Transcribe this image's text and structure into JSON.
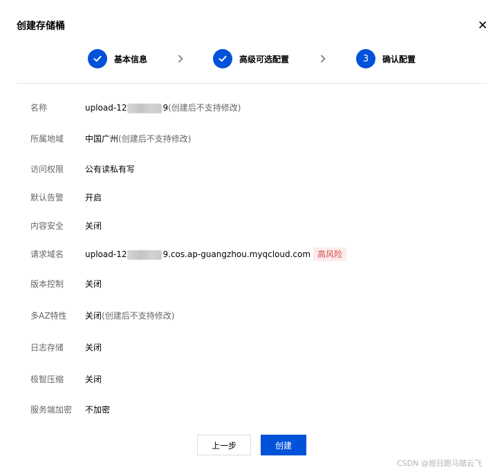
{
  "dialog": {
    "title": "创建存储桶",
    "close_icon": "close-icon"
  },
  "steps": [
    {
      "label": "基本信息",
      "state": "completed",
      "icon": "check-icon"
    },
    {
      "label": "高级可选配置",
      "state": "completed",
      "icon": "check-icon"
    },
    {
      "label": "确认配置",
      "state": "active",
      "number": "3"
    }
  ],
  "fields": {
    "name": {
      "label": "名称",
      "value_prefix": "upload-12",
      "value_suffix": "9",
      "note": "(创建后不支持修改)"
    },
    "region": {
      "label": "所属地域",
      "value": "中国广州",
      "note": "(创建后不支持修改)"
    },
    "access": {
      "label": "访问权限",
      "value": "公有读私有写"
    },
    "alarm": {
      "label": "默认告警",
      "value": "开启"
    },
    "content_security": {
      "label": "内容安全",
      "value": "关闭"
    },
    "domain": {
      "label": "请求域名",
      "value_prefix": "upload-12",
      "value_suffix": "9.cos.ap-guangzhou.myqcloud.com",
      "tag": "高风险"
    },
    "versioning": {
      "label": "版本控制",
      "value": "关闭"
    },
    "multi_az": {
      "label": "多AZ特性",
      "value": "关闭",
      "note": "(创建后不支持修改)"
    },
    "logging": {
      "label": "日志存储",
      "value": "关闭"
    },
    "compression": {
      "label": "极智压缩",
      "value": "关闭"
    },
    "encryption": {
      "label": "服务端加密",
      "value": "不加密"
    }
  },
  "buttons": {
    "prev": "上一步",
    "create": "创建"
  },
  "watermark": "CSDN @旭日跑马踏云飞",
  "colors": {
    "primary": "#0052d9",
    "risk_text": "#d54941",
    "risk_bg": "#fdecee"
  }
}
